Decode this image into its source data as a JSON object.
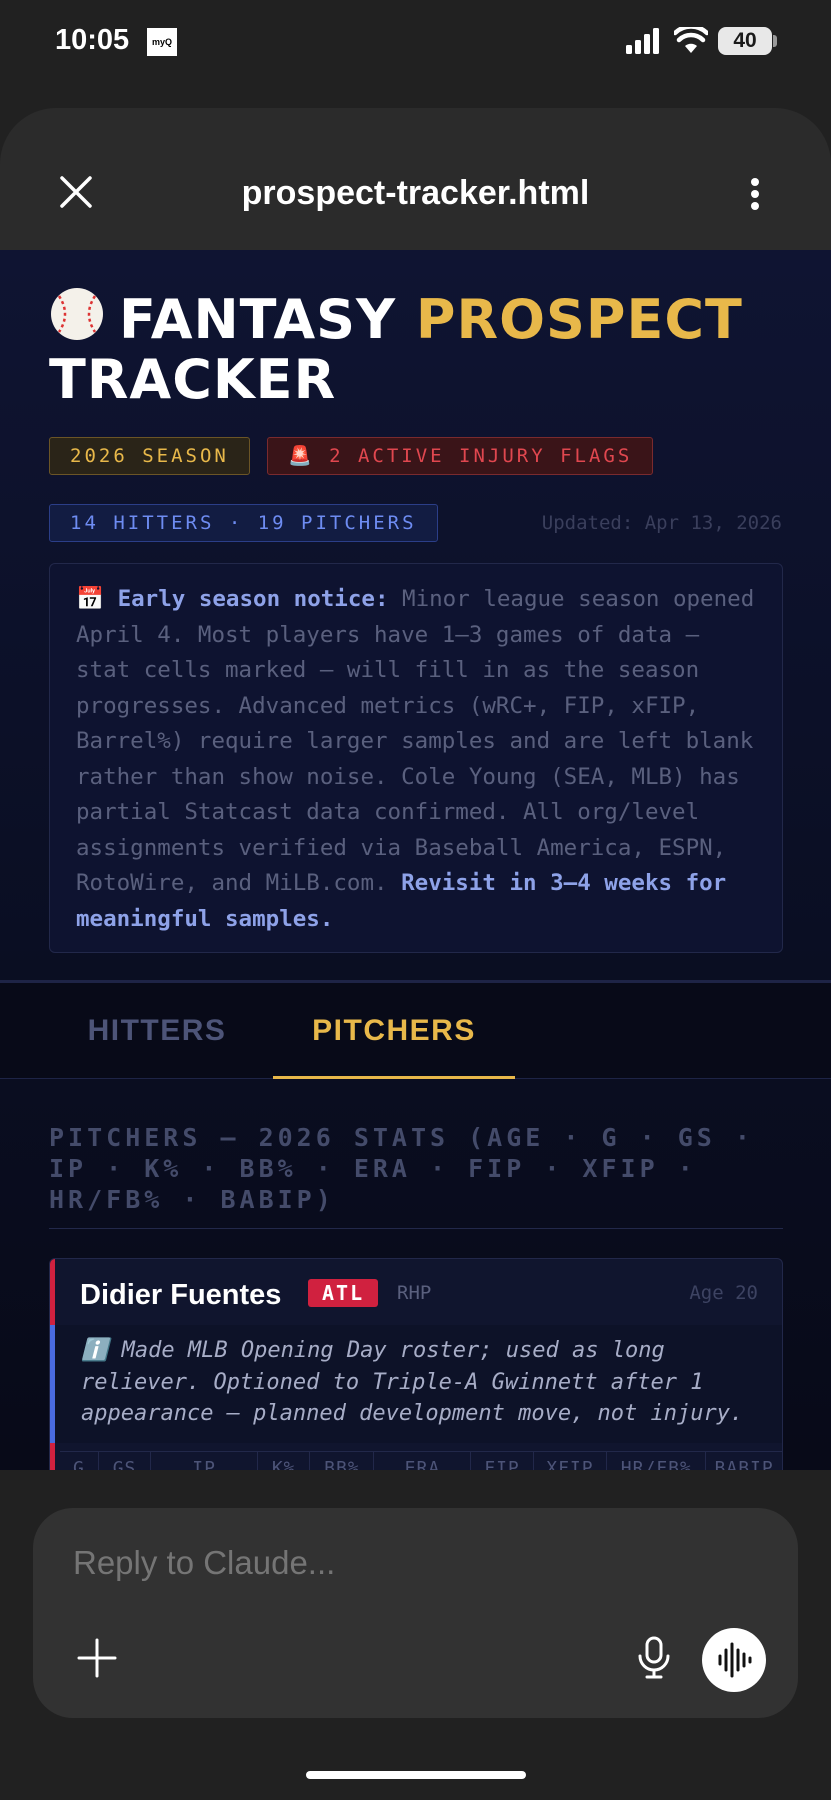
{
  "status_bar": {
    "time": "10:05",
    "app_badge": "myQ",
    "battery": "40"
  },
  "browser": {
    "page_title": "prospect-tracker.html"
  },
  "header": {
    "title_word1": "FANTASY",
    "title_word2": "PROSPECT",
    "title_word3": "TRACKER",
    "badges": {
      "season": "2026 SEASON",
      "injury": "🚨 2 ACTIVE INJURY FLAGS",
      "counts": "14 HITTERS · 19 PITCHERS"
    },
    "updated": "Updated: Apr 13, 2026"
  },
  "notice": {
    "icon": "📅",
    "lead": "Early season notice:",
    "body": " Minor league season opened April 4. Most players have 1–3 games of data — stat cells marked — will fill in as the season progresses. Advanced metrics (wRC+, FIP, xFIP, Barrel%) require larger samples and are left blank rather than show noise. Cole Young (SEA, MLB) has partial Statcast data confirmed. All org/level assignments verified via Baseball America, ESPN, RotoWire, and MiLB.com. ",
    "tail": "Revisit in 3–4 weeks for meaningful samples."
  },
  "tabs": [
    {
      "label": "HITTERS",
      "active": false
    },
    {
      "label": "PITCHERS",
      "active": true
    }
  ],
  "section": {
    "label": "PITCHERS — 2026 STATS (AGE · G · GS · IP · K% · BB% · ERA · FIP · XFIP · HR/FB% · BABIP)"
  },
  "players": [
    {
      "name": "Didier Fuentes",
      "team": "ATL",
      "position": "RHP",
      "age": "Age 20",
      "note_icon": "ℹ️",
      "note": "Made MLB Opening Day roster; used as long reliever. Optioned to Triple-A Gwinnett after 1 appearance — planned development move, not injury.",
      "stat_columns": [
        "G",
        "GS",
        "IP",
        "K%",
        "BB%",
        "ERA",
        "FIP",
        "XFIP",
        "HR/FB%",
        "BABIP"
      ]
    }
  ],
  "composer": {
    "placeholder": "Reply to Claude..."
  },
  "colors": {
    "accent_gold": "#e8b84a",
    "injury_red": "#e0474f",
    "team_atl": "#d0213f",
    "info_blue": "#4a6be0"
  }
}
